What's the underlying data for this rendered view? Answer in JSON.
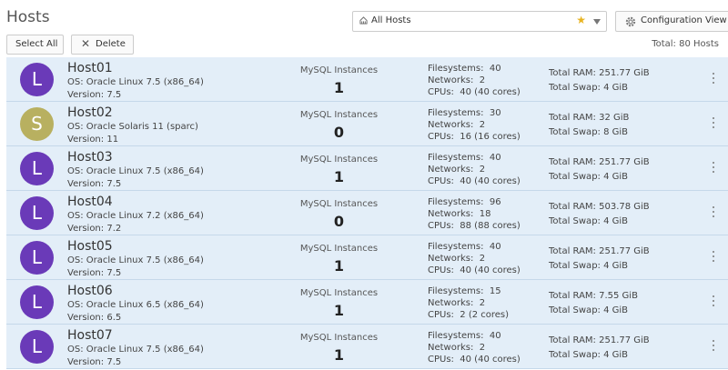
{
  "page": {
    "title": "Hosts"
  },
  "filter": {
    "value": "All Hosts",
    "star_color": "#e8b422"
  },
  "toolbar": {
    "config_view_label": "Configuration View",
    "select_all_label": "Select All",
    "delete_label": "Delete",
    "total_label": "Total: 80 Hosts"
  },
  "labels": {
    "mysql_instances": "MySQL Instances",
    "os_prefix": "OS:",
    "version_prefix": "Version:",
    "filesystems_prefix": "Filesystems:",
    "networks_prefix": "Networks:",
    "cpus_prefix": "CPUs:",
    "total_ram_prefix": "Total RAM:",
    "total_swap_prefix": "Total Swap:"
  },
  "colors": {
    "linux_avatar": "#6a3ab8",
    "solaris_avatar": "#b8b060",
    "selected_row": "#e3eef8"
  },
  "hosts": [
    {
      "initial": "L",
      "avatar_color": "#6a3ab8",
      "name": "Host01",
      "os": "Oracle Linux 7.5  (x86_64)",
      "version": "7.5",
      "instances": "1",
      "filesystems": "40",
      "networks": "2",
      "cpus": "40 (40 cores)",
      "ram": "251.77 GiB",
      "swap": "4 GiB",
      "selected": true
    },
    {
      "initial": "S",
      "avatar_color": "#b8b060",
      "name": "Host02",
      "os": "Oracle Solaris 11  (sparc)",
      "version": "11",
      "instances": "0",
      "filesystems": "30",
      "networks": "2",
      "cpus": "16 (16 cores)",
      "ram": "32 GiB",
      "swap": "8 GiB",
      "selected": false
    },
    {
      "initial": "L",
      "avatar_color": "#6a3ab8",
      "name": "Host03",
      "os": "Oracle Linux 7.5  (x86_64)",
      "version": "7.5",
      "instances": "1",
      "filesystems": "40",
      "networks": "2",
      "cpus": "40 (40 cores)",
      "ram": "251.77 GiB",
      "swap": "4 GiB",
      "selected": false
    },
    {
      "initial": "L",
      "avatar_color": "#6a3ab8",
      "name": "Host04",
      "os": "Oracle Linux 7.2  (x86_64)",
      "version": "7.2",
      "instances": "0",
      "filesystems": "96",
      "networks": "18",
      "cpus": "88 (88 cores)",
      "ram": "503.78 GiB",
      "swap": "4 GiB",
      "selected": false
    },
    {
      "initial": "L",
      "avatar_color": "#6a3ab8",
      "name": "Host05",
      "os": "Oracle Linux 7.5  (x86_64)",
      "version": "7.5",
      "instances": "1",
      "filesystems": "40",
      "networks": "2",
      "cpus": "40 (40 cores)",
      "ram": "251.77 GiB",
      "swap": "4 GiB",
      "selected": false
    },
    {
      "initial": "L",
      "avatar_color": "#6a3ab8",
      "name": "Host06",
      "os": "Oracle Linux 6.5  (x86_64)",
      "version": "6.5",
      "instances": "1",
      "filesystems": "15",
      "networks": "2",
      "cpus": "2 (2 cores)",
      "ram": "7.55 GiB",
      "swap": "4 GiB",
      "selected": false
    },
    {
      "initial": "L",
      "avatar_color": "#6a3ab8",
      "name": "Host07",
      "os": "Oracle Linux 7.5  (x86_64)",
      "version": "7.5",
      "instances": "1",
      "filesystems": "40",
      "networks": "2",
      "cpus": "40 (40 cores)",
      "ram": "251.77 GiB",
      "swap": "4 GiB",
      "selected": false
    }
  ]
}
